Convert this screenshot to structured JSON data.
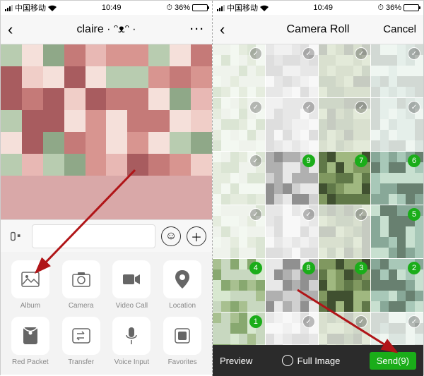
{
  "status": {
    "carrier": "中国移动",
    "time": "10:49",
    "alarm_icon": "⏰",
    "battery_pct": "36%",
    "battery_fill": 36
  },
  "left": {
    "nav_title": "claire · ᵔᴥᵔ ·",
    "actions": [
      {
        "key": "album",
        "label": "Album"
      },
      {
        "key": "camera",
        "label": "Camera"
      },
      {
        "key": "videocall",
        "label": "Video Call"
      },
      {
        "key": "location",
        "label": "Location"
      },
      {
        "key": "redpacket",
        "label": "Red Packet"
      },
      {
        "key": "transfer",
        "label": "Transfer"
      },
      {
        "key": "voiceinput",
        "label": "Voice Input"
      },
      {
        "key": "favorites",
        "label": "Favorites"
      }
    ]
  },
  "right": {
    "nav_title": "Camera Roll",
    "cancel": "Cancel",
    "preview": "Preview",
    "full_image": "Full Image",
    "send_label": "Send(9)",
    "thumbs": [
      {
        "sel": false,
        "num": null,
        "faded": true
      },
      {
        "sel": false,
        "num": null,
        "faded": true
      },
      {
        "sel": false,
        "num": null,
        "faded": true
      },
      {
        "sel": false,
        "num": null,
        "faded": true
      },
      {
        "sel": false,
        "num": null,
        "faded": true
      },
      {
        "sel": false,
        "num": null,
        "faded": true
      },
      {
        "sel": false,
        "num": null,
        "faded": true
      },
      {
        "sel": false,
        "num": null,
        "faded": true
      },
      {
        "sel": false,
        "num": null,
        "faded": true
      },
      {
        "sel": true,
        "num": "9",
        "faded": false
      },
      {
        "sel": true,
        "num": "7",
        "faded": false
      },
      {
        "sel": true,
        "num": "6",
        "faded": false
      },
      {
        "sel": false,
        "num": null,
        "faded": true
      },
      {
        "sel": false,
        "num": null,
        "faded": true
      },
      {
        "sel": false,
        "num": null,
        "faded": true
      },
      {
        "sel": true,
        "num": "5",
        "faded": false
      },
      {
        "sel": true,
        "num": "4",
        "faded": false
      },
      {
        "sel": true,
        "num": "8",
        "faded": false
      },
      {
        "sel": true,
        "num": "3",
        "faded": false
      },
      {
        "sel": true,
        "num": "2",
        "faded": false
      },
      {
        "sel": true,
        "num": "1",
        "faded": false
      },
      {
        "sel": false,
        "num": null,
        "faded": true
      },
      {
        "sel": false,
        "num": null,
        "faded": true
      },
      {
        "sel": false,
        "num": null,
        "faded": true
      }
    ]
  },
  "colors": {
    "accent": "#1aad19",
    "arrow": "#b01518"
  }
}
